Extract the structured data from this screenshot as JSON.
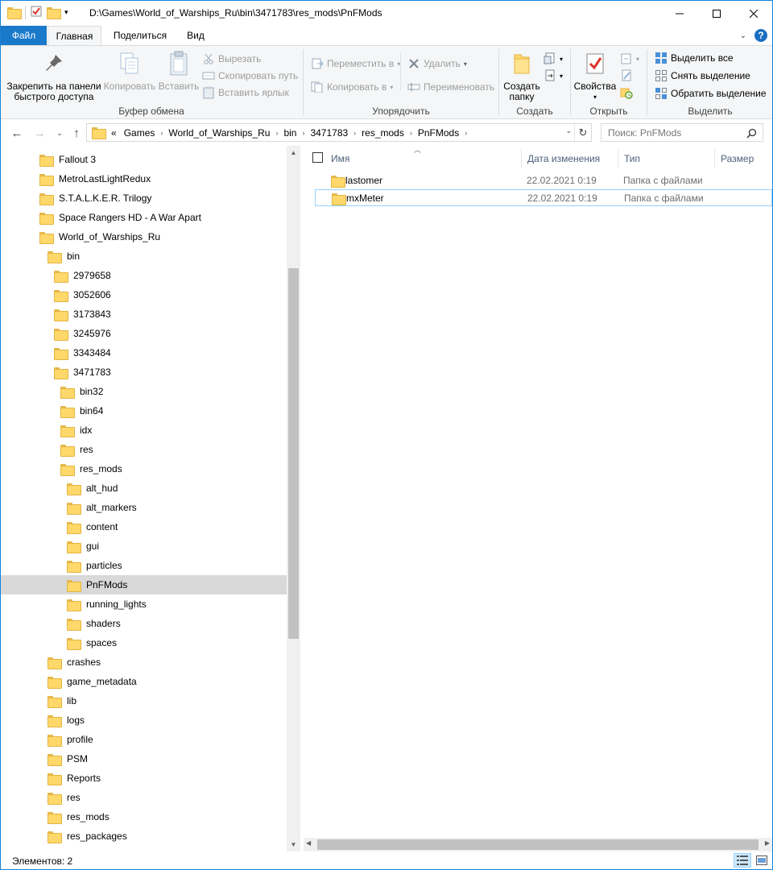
{
  "window": {
    "title": "D:\\Games\\World_of_Warships_Ru\\bin\\3471783\\res_mods\\PnFMods"
  },
  "ribbon_tabs": {
    "file": "Файл",
    "home": "Главная",
    "share": "Поделиться",
    "view": "Вид"
  },
  "clipboard": {
    "pin": "Закрепить на панели быстрого доступа",
    "copy": "Копировать",
    "paste": "Вставить",
    "cut": "Вырезать",
    "copy_path": "Скопировать путь",
    "paste_shortcut": "Вставить ярлык",
    "label": "Буфер обмена"
  },
  "organize": {
    "move_to": "Переместить в",
    "copy_to": "Копировать в",
    "delete": "Удалить",
    "rename": "Переименовать",
    "label": "Упорядочить"
  },
  "new": {
    "new_folder": "Создать папку",
    "label": "Создать"
  },
  "open": {
    "properties": "Свойства",
    "label": "Открыть"
  },
  "select": {
    "select_all": "Выделить все",
    "select_none": "Снять выделение",
    "invert": "Обратить выделение",
    "label": "Выделить"
  },
  "address": {
    "overflow": "«",
    "crumbs": [
      "Games",
      "World_of_Warships_Ru",
      "bin",
      "3471783",
      "res_mods",
      "PnFMods"
    ]
  },
  "search": {
    "placeholder": "Поиск: PnFMods"
  },
  "tree": [
    {
      "label": "Fallout 3",
      "level": 0
    },
    {
      "label": "MetroLastLightRedux",
      "level": 0
    },
    {
      "label": "S.T.A.L.K.E.R. Trilogy",
      "level": 0
    },
    {
      "label": "Space Rangers HD - A War Apart",
      "level": 0
    },
    {
      "label": "World_of_Warships_Ru",
      "level": 0
    },
    {
      "label": "bin",
      "level": 1
    },
    {
      "label": "2979658",
      "level": 2
    },
    {
      "label": "3052606",
      "level": 2
    },
    {
      "label": "3173843",
      "level": 2
    },
    {
      "label": "3245976",
      "level": 2
    },
    {
      "label": "3343484",
      "level": 2
    },
    {
      "label": "3471783",
      "level": 2
    },
    {
      "label": "bin32",
      "level": 3
    },
    {
      "label": "bin64",
      "level": 3
    },
    {
      "label": "idx",
      "level": 3
    },
    {
      "label": "res",
      "level": 3
    },
    {
      "label": "res_mods",
      "level": 3
    },
    {
      "label": "alt_hud",
      "level": 4
    },
    {
      "label": "alt_markers",
      "level": 4
    },
    {
      "label": "content",
      "level": 4
    },
    {
      "label": "gui",
      "level": 4
    },
    {
      "label": "particles",
      "level": 4
    },
    {
      "label": "PnFMods",
      "level": 4,
      "selected": true
    },
    {
      "label": "running_lights",
      "level": 4
    },
    {
      "label": "shaders",
      "level": 4
    },
    {
      "label": "spaces",
      "level": 4
    },
    {
      "label": "crashes",
      "level": 1
    },
    {
      "label": "game_metadata",
      "level": 1
    },
    {
      "label": "lib",
      "level": 1
    },
    {
      "label": "logs",
      "level": 1
    },
    {
      "label": "profile",
      "level": 1
    },
    {
      "label": "PSM",
      "level": 1
    },
    {
      "label": "Reports",
      "level": 1
    },
    {
      "label": "res",
      "level": 1
    },
    {
      "label": "res_mods",
      "level": 1
    },
    {
      "label": "res_packages",
      "level": 1
    }
  ],
  "columns": {
    "name": "Имя",
    "date": "Дата изменения",
    "type": "Тип",
    "size": "Размер"
  },
  "files": [
    {
      "name": "lastomer",
      "date": "22.02.2021 0:19",
      "type": "Папка с файлами"
    },
    {
      "name": "mxMeter",
      "date": "22.02.2021 0:19",
      "type": "Папка с файлами",
      "focused": true
    }
  ],
  "status": {
    "items": "Элементов: 2"
  },
  "colors": {
    "accent": "#1979ca",
    "folder": "#ffd86b",
    "selection": "#d9d9d9"
  }
}
